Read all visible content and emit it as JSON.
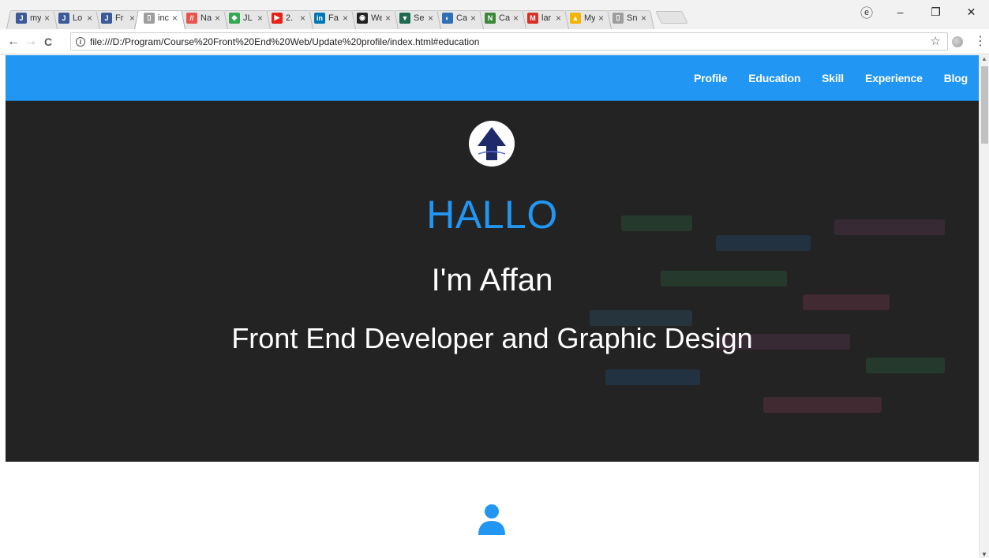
{
  "browser": {
    "tabs": [
      {
        "title": "my",
        "favicon": "jsfiddle-icon",
        "color": "#3d5a98",
        "glyph": "J",
        "active": false
      },
      {
        "title": "Lo",
        "favicon": "jsfiddle-icon",
        "color": "#3d5a98",
        "glyph": "J",
        "active": false
      },
      {
        "title": "Fr",
        "favicon": "jsfiddle-icon",
        "color": "#3d5a98",
        "glyph": "J",
        "active": false
      },
      {
        "title": "inc",
        "favicon": "document-icon",
        "color": "#9e9e9e",
        "glyph": "▯",
        "active": true
      },
      {
        "title": "Na",
        "favicon": "stripes-icon",
        "color": "#e8554e",
        "glyph": "//",
        "active": false
      },
      {
        "title": "JL",
        "favicon": "maps-icon",
        "color": "#34a853",
        "glyph": "◆",
        "active": false
      },
      {
        "title": "2.",
        "favicon": "youtube-icon",
        "color": "#e62117",
        "glyph": "▶",
        "active": false
      },
      {
        "title": "Fa",
        "favicon": "linkedin-icon",
        "color": "#0077b5",
        "glyph": "in",
        "active": false
      },
      {
        "title": "We",
        "favicon": "camera-icon",
        "color": "#222222",
        "glyph": "◉",
        "active": false
      },
      {
        "title": "Se",
        "favicon": "filter-icon",
        "color": "#1e6b52",
        "glyph": "▼",
        "active": false
      },
      {
        "title": "Ca",
        "favicon": "circle-icon",
        "color": "#2f6fb3",
        "glyph": "◐",
        "active": false
      },
      {
        "title": "Ca",
        "favicon": "nodejs-icon",
        "color": "#3c873a",
        "glyph": "N",
        "active": false
      },
      {
        "title": "lar",
        "favicon": "gmail-icon",
        "color": "#d93025",
        "glyph": "M",
        "active": false
      },
      {
        "title": "My",
        "favicon": "drive-icon",
        "color": "#f4b400",
        "glyph": "▲",
        "active": false
      },
      {
        "title": "Sn",
        "favicon": "document-icon",
        "color": "#9e9e9e",
        "glyph": "▯",
        "active": false
      }
    ],
    "tab_close": "×",
    "url": "file:///D:/Program/Course%20Front%20End%20Web/Update%20profile/index.html#education",
    "icons": {
      "back": "←",
      "forward": "→",
      "reload": "C",
      "info": "i",
      "star": "☆",
      "menu": "⋮",
      "minimize": "–",
      "restore": "❐",
      "close": "✕",
      "profile": "ⓔ"
    }
  },
  "site": {
    "nav": [
      "Profile",
      "Education",
      "Skill",
      "Experience",
      "Blog"
    ],
    "hero": {
      "greeting": "HALLO",
      "name": "I'm Affan",
      "role": "Front End Developer and Graphic Design"
    },
    "colors": {
      "primary": "#2196f3",
      "logo_arrow": "#1f2a6b",
      "hero_bg": "#2b2b2b"
    }
  }
}
